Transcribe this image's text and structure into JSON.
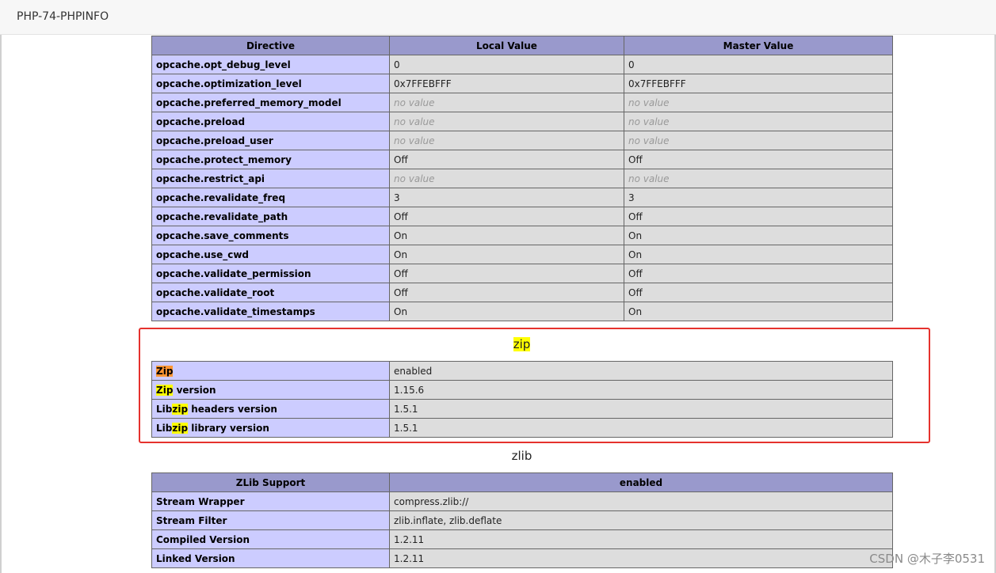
{
  "window": {
    "tab_title": "PHP-74-PHPINFO"
  },
  "opcache": {
    "headers": [
      "Directive",
      "Local Value",
      "Master Value"
    ],
    "rows": [
      {
        "name": "opcache.opt_debug_level",
        "local": "0",
        "master": "0"
      },
      {
        "name": "opcache.optimization_level",
        "local": "0x7FFEBFFF",
        "master": "0x7FFEBFFF"
      },
      {
        "name": "opcache.preferred_memory_model",
        "local": "no value",
        "master": "no value"
      },
      {
        "name": "opcache.preload",
        "local": "no value",
        "master": "no value"
      },
      {
        "name": "opcache.preload_user",
        "local": "no value",
        "master": "no value"
      },
      {
        "name": "opcache.protect_memory",
        "local": "Off",
        "master": "Off"
      },
      {
        "name": "opcache.restrict_api",
        "local": "no value",
        "master": "no value"
      },
      {
        "name": "opcache.revalidate_freq",
        "local": "3",
        "master": "3"
      },
      {
        "name": "opcache.revalidate_path",
        "local": "Off",
        "master": "Off"
      },
      {
        "name": "opcache.save_comments",
        "local": "On",
        "master": "On"
      },
      {
        "name": "opcache.use_cwd",
        "local": "On",
        "master": "On"
      },
      {
        "name": "opcache.validate_permission",
        "local": "Off",
        "master": "Off"
      },
      {
        "name": "opcache.validate_root",
        "local": "Off",
        "master": "Off"
      },
      {
        "name": "opcache.validate_timestamps",
        "local": "On",
        "master": "On"
      }
    ]
  },
  "zip": {
    "title": "zip",
    "rows": [
      {
        "pre": "",
        "hl": "Zip",
        "post": "",
        "value": "enabled",
        "current": true
      },
      {
        "pre": "",
        "hl": "Zip",
        "post": " version",
        "value": "1.15.6",
        "current": false
      },
      {
        "pre": "Lib",
        "hl": "zip",
        "post": " headers version",
        "value": "1.5.1",
        "current": false
      },
      {
        "pre": "Lib",
        "hl": "zip",
        "post": " library version",
        "value": "1.5.1",
        "current": false
      }
    ]
  },
  "zlib": {
    "title": "zlib",
    "headers": [
      "ZLib Support",
      "enabled"
    ],
    "rows": [
      {
        "name": "Stream Wrapper",
        "value": "compress.zlib://"
      },
      {
        "name": "Stream Filter",
        "value": "zlib.inflate, zlib.deflate"
      },
      {
        "name": "Compiled Version",
        "value": "1.2.11"
      },
      {
        "name": "Linked Version",
        "value": "1.2.11"
      }
    ]
  },
  "watermark": "CSDN @木子李0531",
  "colors": {
    "header_bg": "#9999cc",
    "key_bg": "#ccccff",
    "value_bg": "#dddddd",
    "search_highlight": "#ffff00",
    "search_current": "#ff9632",
    "annotation_box": "#e5322d"
  }
}
